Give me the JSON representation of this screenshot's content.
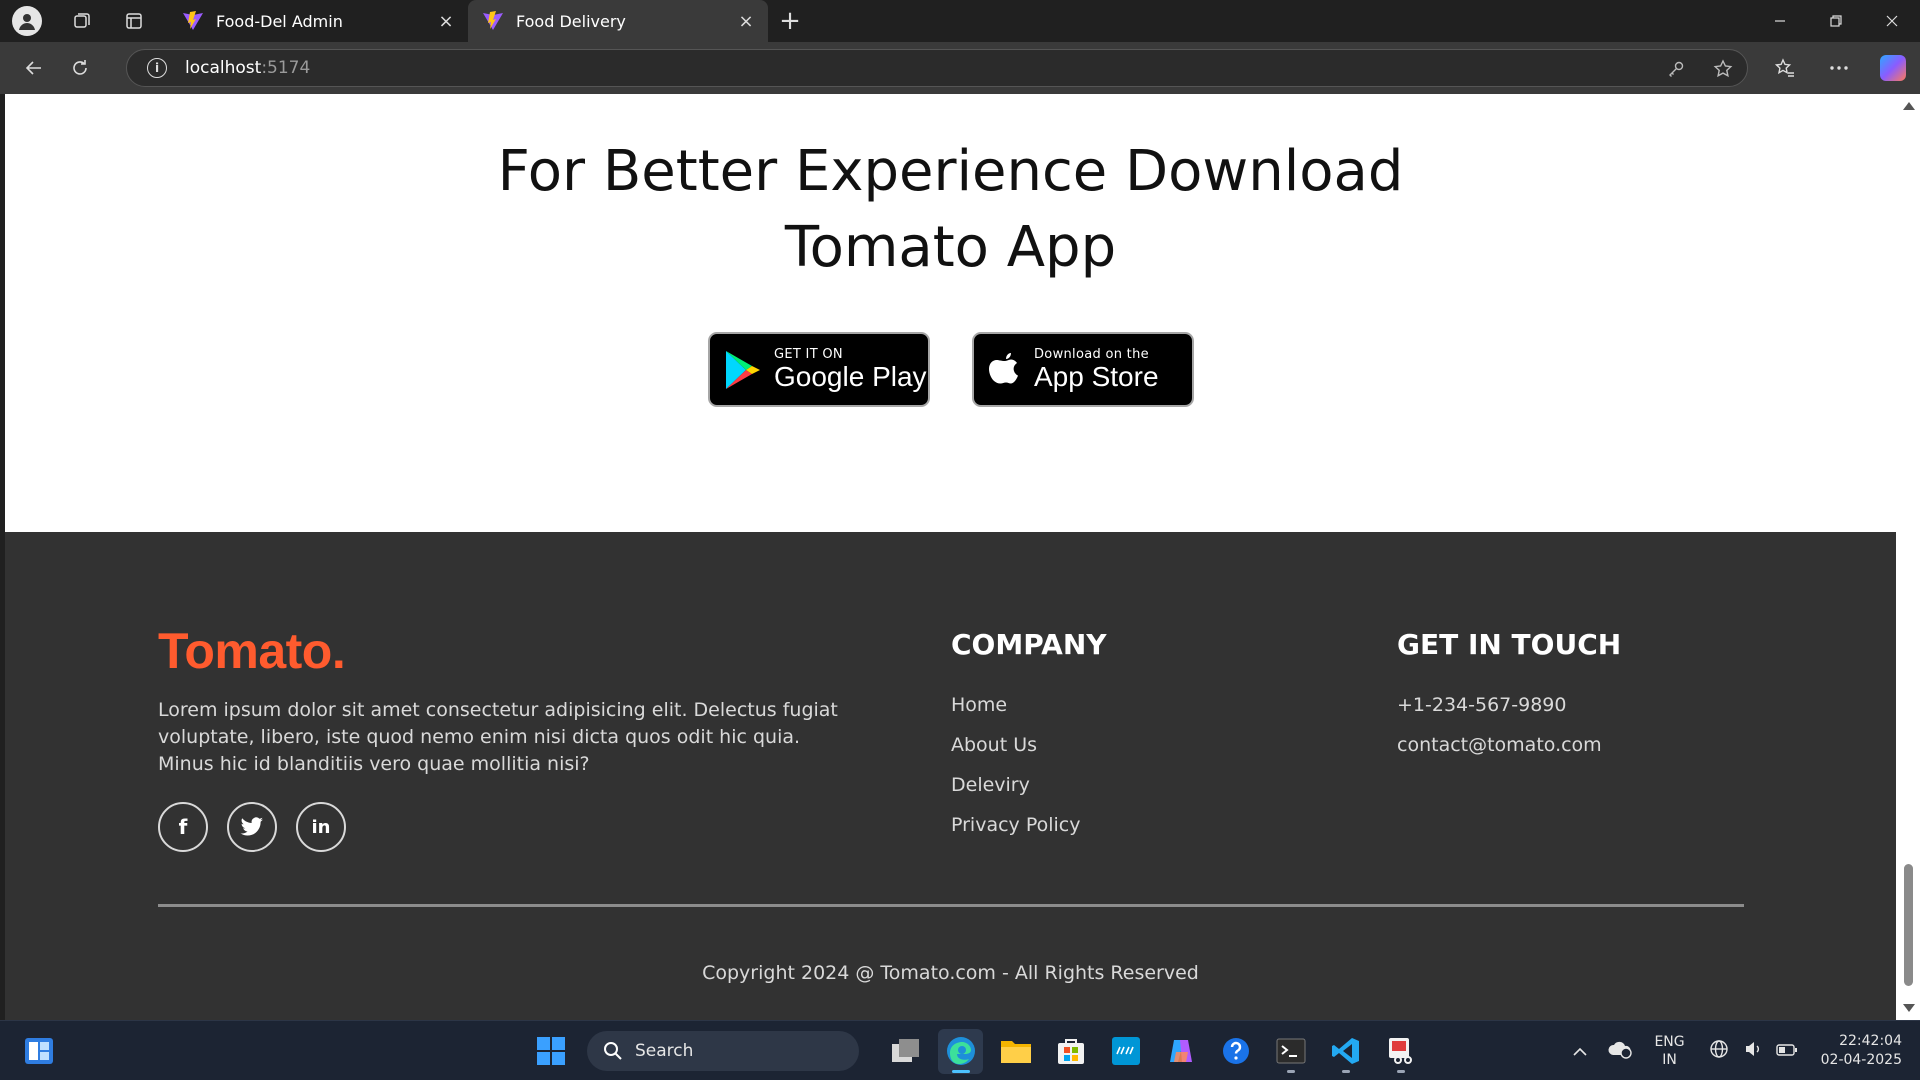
{
  "browser": {
    "tabs": [
      {
        "title": "Food-Del Admin",
        "active": false
      },
      {
        "title": "Food Delivery",
        "active": true
      }
    ],
    "close_glyph": "×",
    "new_tab_glyph": "+",
    "url_host": "localhost",
    "url_port": ":5174",
    "info_glyph": "i"
  },
  "download": {
    "title_line1": "For Better Experience Download",
    "title_line2": "Tomato App",
    "google_play": {
      "small": "GET IT ON",
      "big": "Google Play"
    },
    "app_store": {
      "small": "Download on the",
      "big": "App Store"
    }
  },
  "footer": {
    "brand": "Tomato.",
    "brand_color": "#ff5b2e",
    "about": "Lorem ipsum dolor sit amet consectetur adipisicing elit. Delectus fugiat voluptate, libero, iste quod nemo enim nisi dicta quos odit hic quia. Minus hic id blanditiis vero quae mollitia nisi?",
    "socials": [
      {
        "icon": "facebook-icon",
        "glyph": "f"
      },
      {
        "icon": "twitter-icon",
        "glyph": ""
      },
      {
        "icon": "linkedin-icon",
        "glyph": "in"
      }
    ],
    "company_heading": "COMPANY",
    "company_links": [
      "Home",
      "About Us",
      "Deleviry",
      "Privacy Policy"
    ],
    "contact_heading": "GET IN TOUCH",
    "contact_items": [
      "+1-234-567-9890",
      "contact@tomato.com"
    ],
    "copyright": "Copyright 2024 @ Tomato.com - All Rights Reserved"
  },
  "taskbar": {
    "search_label": "Search",
    "lang_line1": "ENG",
    "lang_line2": "IN",
    "time": "22:42:04",
    "date": "02-04-2025"
  }
}
